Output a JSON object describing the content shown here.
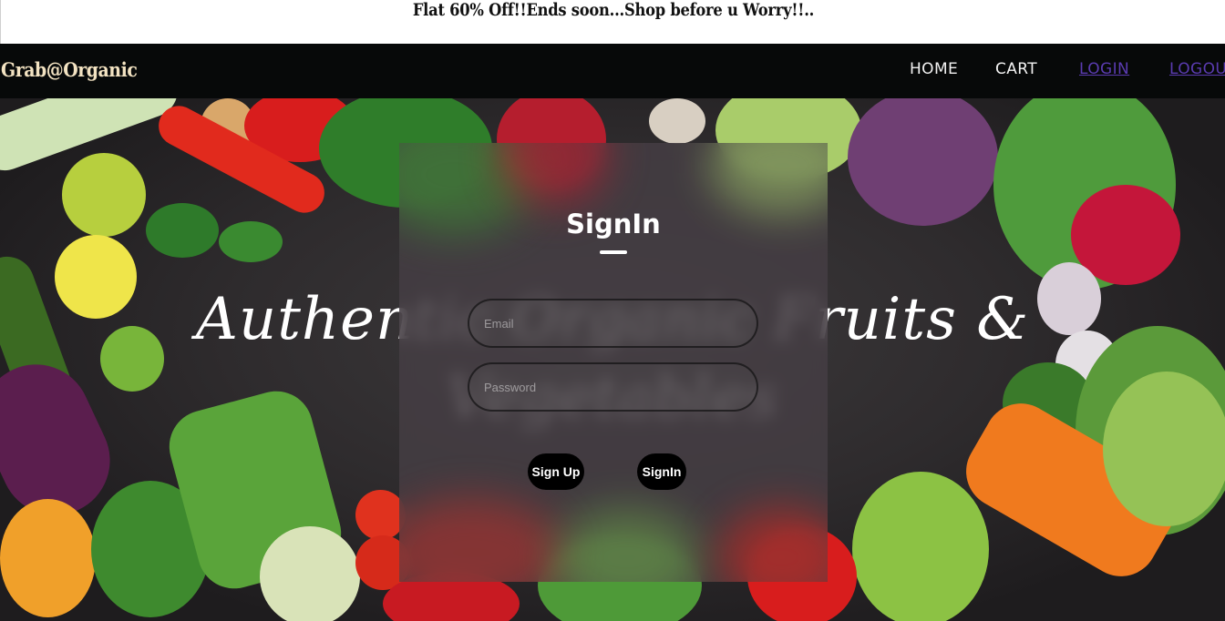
{
  "promo": {
    "text": "Flat 60% Off!!Ends soon...Shop before u Worry!!.."
  },
  "nav": {
    "brand": "Grab@Organic",
    "links": [
      {
        "label": "HOME"
      },
      {
        "label": "CART"
      },
      {
        "label": "LOGIN"
      },
      {
        "label": "LOGOUT"
      }
    ]
  },
  "hero": {
    "title_line1": "Authentic Organic Fruits &",
    "title_line2": "Vegetables"
  },
  "signin": {
    "title": "SignIn",
    "email_placeholder": "Email",
    "password_placeholder": "Password",
    "signup_label": "Sign Up",
    "signin_label": "SignIn"
  },
  "colors": {
    "nav_bg": "#070909",
    "brand": "#f3e3c2",
    "visited_link": "#5a3bb0",
    "button_bg": "#000000"
  }
}
